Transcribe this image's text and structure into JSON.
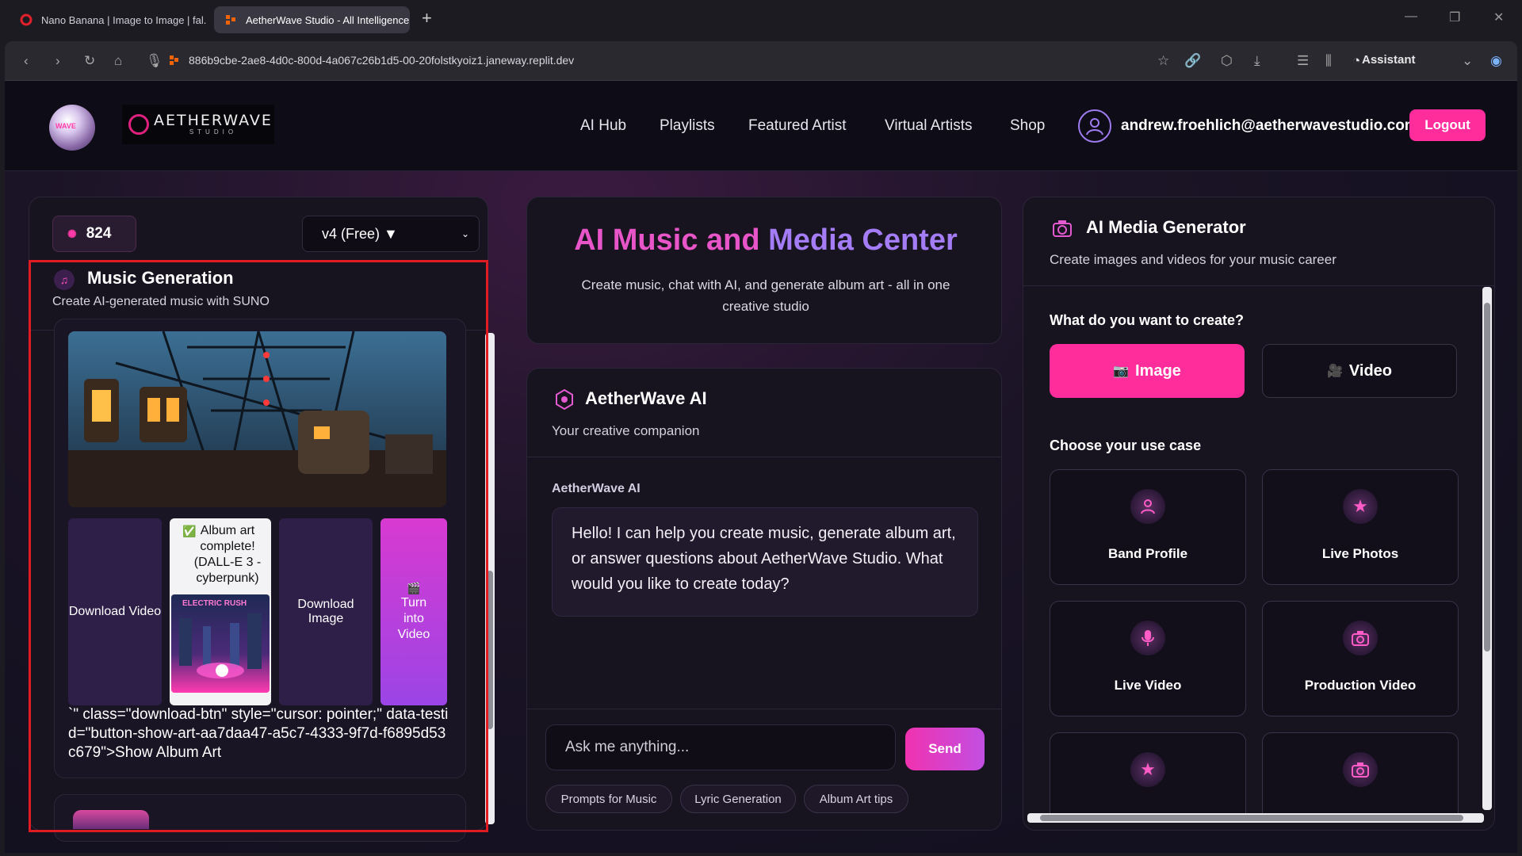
{
  "browser": {
    "tabs": [
      {
        "label": "Nano Banana | Image to Image | fal."
      },
      {
        "label": "AetherWave Studio - All Intelligence"
      }
    ],
    "url": "886b9cbe-2ae8-4d0c-800d-4a067c26b1d5-00-20folstkyoiz1.janeway.replit.dev",
    "assistant_label": "Assistant"
  },
  "header": {
    "logo_text": "WAVE",
    "brand_title": "AETHERWAVE",
    "brand_subtitle": "STUDIO",
    "nav": [
      "AI Hub",
      "Playlists",
      "Featured Artist",
      "Virtual Artists",
      "Shop"
    ],
    "user_email": "andrew.froehlich@aetherwavestudio.com",
    "logout_label": "Logout"
  },
  "left_panel": {
    "credits": "824",
    "model_select": "v4 (Free) ▼",
    "title": "Music Generation",
    "subtitle": "Create AI-generated music with SUNO",
    "tiles": {
      "download_video": "Download Video",
      "album_art_status": "Album art complete! (DALL-E 3 - cyberpunk)",
      "album_art_check": "✅",
      "album_art_image_text": "ELECTRIC RUSH",
      "download_image": "Download Image",
      "turn_into_video_icon": "🎬",
      "turn_into_video": "Turn into Video"
    },
    "leaked_code": "`\" class=\"download-btn\" style=\"cursor: pointer;\" data-testid=\"button-show-art-aa7daa47-a5c7-4333-9f7d-f6895d53c679\">Show Album Art"
  },
  "center_panel": {
    "title_part1": "AI Music and ",
    "title_part2": "Media Center",
    "subtitle": "Create music, chat with AI, and generate album art - all in one creative studio",
    "chat_title": "AetherWave AI",
    "chat_subtitle": "Your creative companion",
    "message_sender": "AetherWave AI",
    "message_text": "Hello! I can help you create music, generate album art, or answer questions about AetherWave Studio. What would you like to create today?",
    "input_placeholder": "Ask me anything...",
    "send_label": "Send",
    "chips": [
      "Prompts for Music",
      "Lyric Generation",
      "Album Art tips"
    ]
  },
  "right_panel": {
    "title": "AI Media Generator",
    "subtitle": "Create images and videos for your music career",
    "question": "What do you want to create?",
    "mode_image": "Image",
    "mode_image_icon": "📷",
    "mode_video": "Video",
    "mode_video_icon": "🎥",
    "use_case_label": "Choose your use case",
    "use_cases": [
      {
        "label": "Band Profile",
        "icon": "person-icon"
      },
      {
        "label": "Live Photos",
        "icon": "star-icon"
      },
      {
        "label": "Live Video",
        "icon": "microphone-icon"
      },
      {
        "label": "Production Video",
        "icon": "camera-icon"
      },
      {
        "label": "",
        "icon": "star-icon"
      },
      {
        "label": "",
        "icon": "camera-icon"
      }
    ]
  },
  "colors": {
    "accent_pink": "#ff2d9c",
    "accent_purple": "#a47cf5",
    "highlight_box": "#e11b22"
  }
}
